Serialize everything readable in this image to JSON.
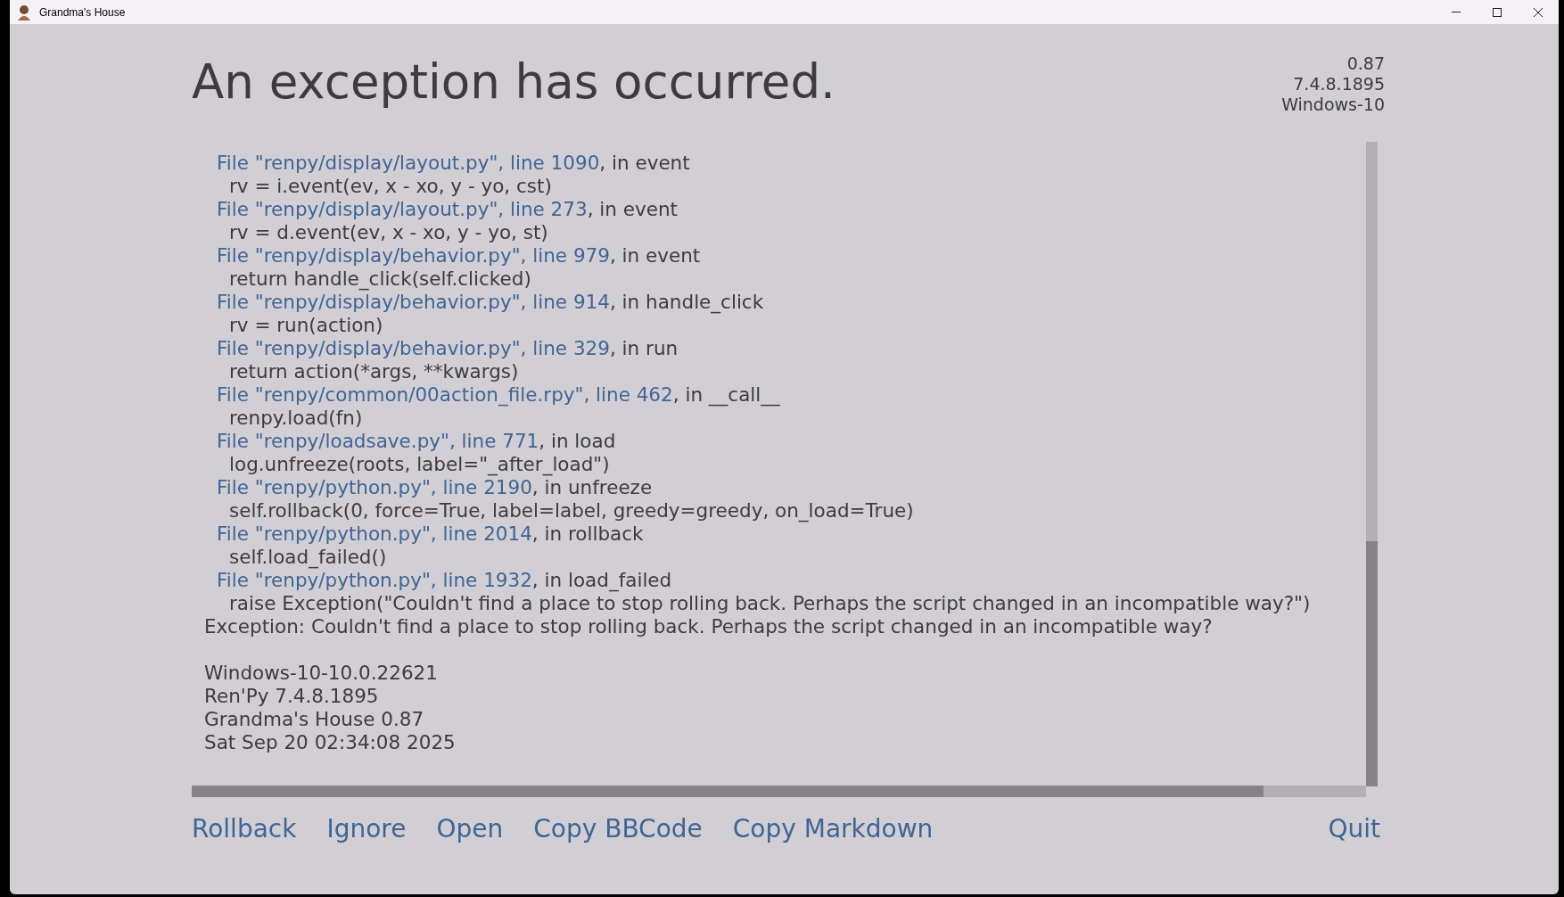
{
  "window": {
    "title": "Grandma's House"
  },
  "heading": "An exception has occurred.",
  "version_info": [
    "0.87",
    "7.4.8.1895",
    "Windows-10"
  ],
  "traceback": [
    {
      "kind": "file",
      "link": "File \"renpy/display/layout.py\", line 1090",
      "rest": ", in event"
    },
    {
      "kind": "code",
      "text": "rv = i.event(ev, x - xo, y - yo, cst)"
    },
    {
      "kind": "file",
      "link": "File \"renpy/display/layout.py\", line 273",
      "rest": ", in event"
    },
    {
      "kind": "code",
      "text": "rv = d.event(ev, x - xo, y - yo, st)"
    },
    {
      "kind": "file",
      "link": "File \"renpy/display/behavior.py\", line 979",
      "rest": ", in event"
    },
    {
      "kind": "code",
      "text": "return handle_click(self.clicked)"
    },
    {
      "kind": "file",
      "link": "File \"renpy/display/behavior.py\", line 914",
      "rest": ", in handle_click"
    },
    {
      "kind": "code",
      "text": "rv = run(action)"
    },
    {
      "kind": "file",
      "link": "File \"renpy/display/behavior.py\", line 329",
      "rest": ", in run"
    },
    {
      "kind": "code",
      "text": "return action(*args, **kwargs)"
    },
    {
      "kind": "file",
      "link": "File \"renpy/common/00action_file.rpy\", line 462",
      "rest": ", in __call__"
    },
    {
      "kind": "code",
      "text": "renpy.load(fn)"
    },
    {
      "kind": "file",
      "link": "File \"renpy/loadsave.py\", line 771",
      "rest": ", in load"
    },
    {
      "kind": "code",
      "text": "log.unfreeze(roots, label=\"_after_load\")"
    },
    {
      "kind": "file",
      "link": "File \"renpy/python.py\", line 2190",
      "rest": ", in unfreeze"
    },
    {
      "kind": "code",
      "text": "self.rollback(0, force=True, label=label, greedy=greedy, on_load=True)"
    },
    {
      "kind": "file",
      "link": "File \"renpy/python.py\", line 2014",
      "rest": ", in rollback"
    },
    {
      "kind": "code",
      "text": "self.load_failed()"
    },
    {
      "kind": "file",
      "link": "File \"renpy/python.py\", line 1932",
      "rest": ", in load_failed"
    },
    {
      "kind": "code",
      "text": "raise Exception(\"Couldn't find a place to stop rolling back. Perhaps the script changed in an incompatible way?\")"
    },
    {
      "kind": "plain",
      "text": "Exception: Couldn't find a place to stop rolling back. Perhaps the script changed in an incompatible way?"
    },
    {
      "kind": "blank"
    },
    {
      "kind": "plain",
      "text": "Windows-10-10.0.22621"
    },
    {
      "kind": "plain",
      "text": "Ren'Py 7.4.8.1895"
    },
    {
      "kind": "plain",
      "text": "Grandma's House 0.87"
    },
    {
      "kind": "plain",
      "text": "Sat Sep 20 02:34:08 2025"
    }
  ],
  "actions": [
    {
      "label": "Rollback",
      "kind": "left"
    },
    {
      "label": "Ignore",
      "kind": "left"
    },
    {
      "label": "Open",
      "kind": "left"
    },
    {
      "label": "Copy BBCode",
      "kind": "left"
    },
    {
      "label": "Copy Markdown",
      "kind": "left"
    },
    {
      "label": "Quit",
      "kind": "right"
    }
  ]
}
